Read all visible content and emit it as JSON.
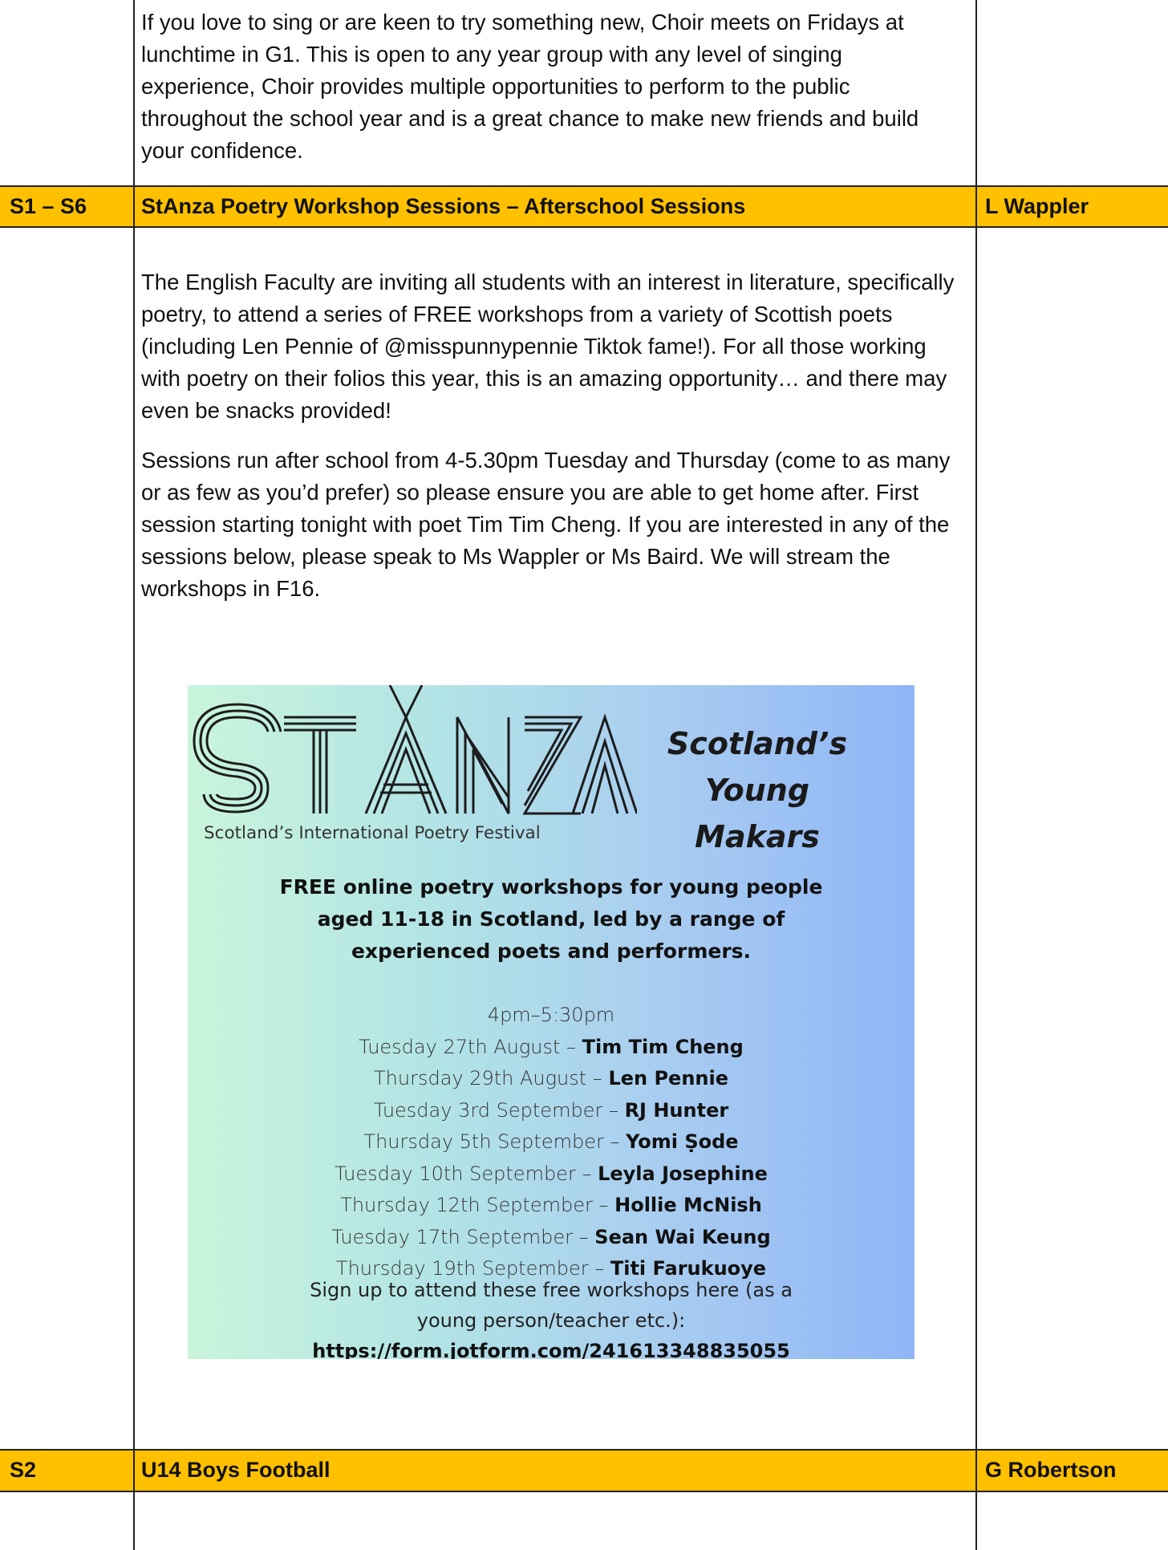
{
  "choir": {
    "text": "If you love to sing or are keen to try something new, Choir meets on Fridays at lunchtime in G1. This is open to any year group with any level of singing experience, Choir provides multiple opportunities to perform to the public throughout the school year and is a great chance to make new friends and build your confidence."
  },
  "stanza_row": {
    "years": "S1 – S6",
    "title": "StAnza Poetry Workshop Sessions – Afterschool Sessions",
    "staff": "L Wappler",
    "para1": "The English Faculty are inviting all students with an interest in literature, specifically poetry, to attend a series of FREE workshops from a variety of Scottish poets (including Len Pennie of @misspunnypennie Tiktok fame!). For all those working with poetry on their folios this year, this is an amazing opportunity… and there may even be snacks provided!",
    "para2": "Sessions run after school from 4-5.30pm Tuesday and Thursday (come to as many or as few as you’d prefer) so please ensure you are able to get home after. First session starting tonight with poet Tim Tim Cheng. If you are interested in any of the sessions below, please speak to Ms Wappler or Ms Baird. We will stream the workshops in F16."
  },
  "poster": {
    "logo_text": "STANZA",
    "tagline": "Scotland’s International Poetry Festival",
    "young_makars": [
      "Scotland’s",
      "Young",
      "Makars"
    ],
    "lead": [
      "FREE online poetry workshops for young people",
      "aged 11-18 in Scotland, led by a range of",
      "experienced poets and performers."
    ],
    "time": "4pm–5:30pm",
    "sessions": [
      {
        "date": "Tuesday 27th August – ",
        "poet": "Tim Tim Cheng"
      },
      {
        "date": "Thursday 29th August – ",
        "poet": "Len Pennie"
      },
      {
        "date": "Tuesday 3rd September – ",
        "poet": "RJ Hunter"
      },
      {
        "date": "Thursday 5th September – ",
        "poet": "Yomi Ṣode"
      },
      {
        "date": "Tuesday 10th September – ",
        "poet": "Leyla Josephine"
      },
      {
        "date": "Thursday 12th September – ",
        "poet": "Hollie McNish"
      },
      {
        "date": "Tuesday 17th September – ",
        "poet": "Sean Wai Keung"
      },
      {
        "date": "Thursday 19th September – ",
        "poet": "Titi Farukuoye"
      }
    ],
    "signup": [
      "Sign up to attend these free workshops here (as a",
      "young person/teacher etc.):"
    ],
    "url": "https://form.jotform.com/241613348835055"
  },
  "football_row": {
    "years": "S2",
    "title": "U14 Boys Football",
    "staff": "G Robertson"
  }
}
